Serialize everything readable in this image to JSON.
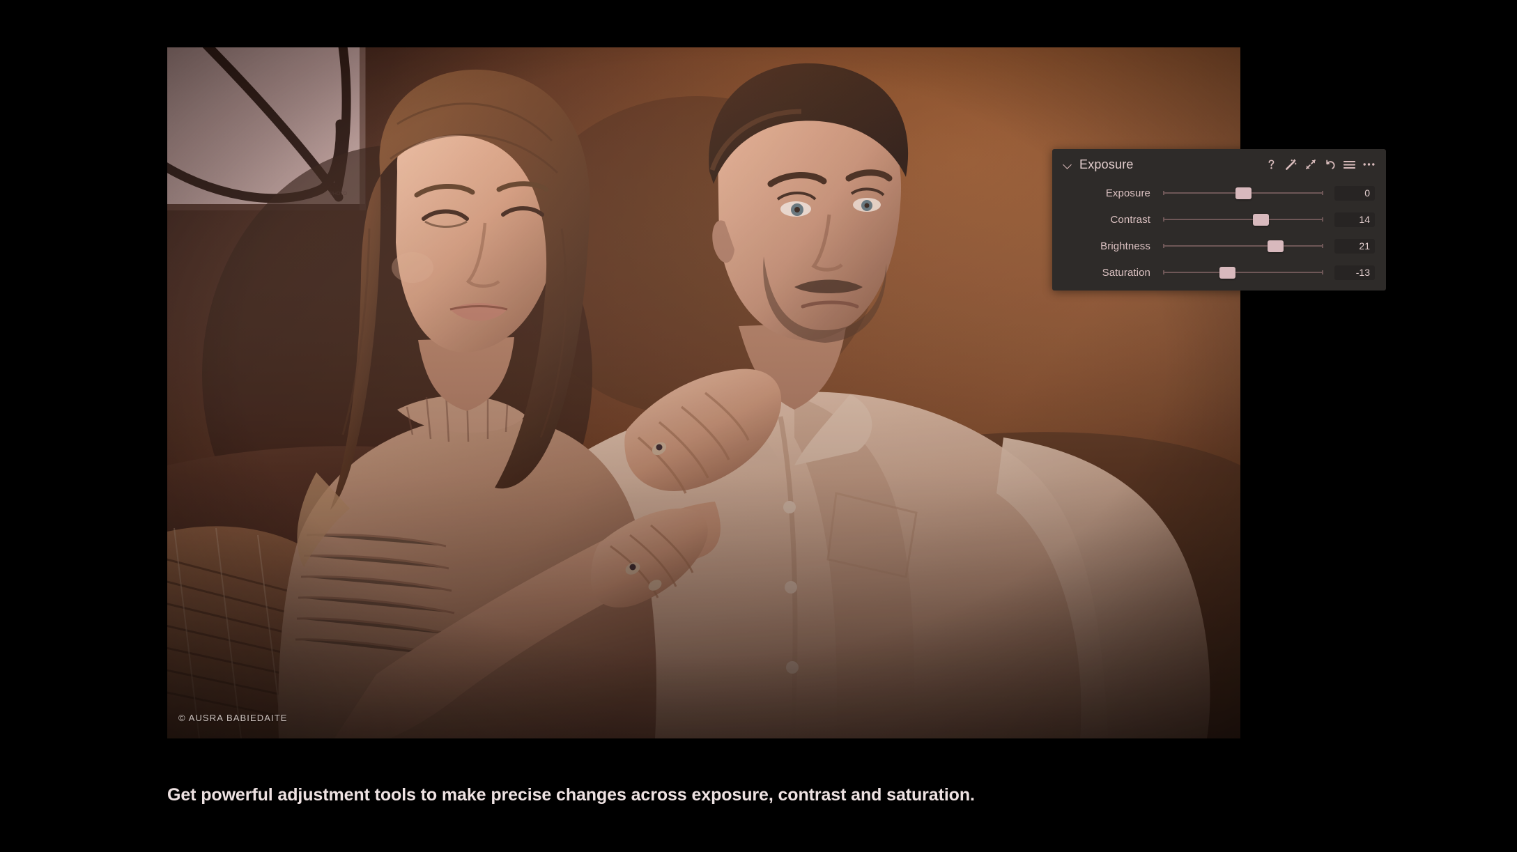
{
  "photo": {
    "watermark": "© AUSRA BABIEDAITE",
    "alt": "Couple seated on a sofa in a warm dim room, woman resting hand on man's shoulder",
    "palette": {
      "wall_warm": "#7a4427",
      "wall_dark": "#3a211a",
      "wall_deep": "#281511",
      "skin_light": "#e3b49c",
      "skin_mid": "#c08d74",
      "skin_shadow": "#8a5c49",
      "hair_dark": "#4a2c1f",
      "hair_mid": "#7d4f33",
      "shirt_light": "#e8cab6",
      "shirt_shadow": "#c39e89",
      "sweater": "#c49a83",
      "canvas_art": "#a78b8b",
      "canvas_line": "#2a1712",
      "sofa": "#4d2b21",
      "pillow": "#a36b4a"
    }
  },
  "panel": {
    "title": "Exposure",
    "collapse_icon": "chevron-down-icon",
    "header_icons": [
      {
        "name": "help-icon",
        "glyph": "?"
      },
      {
        "name": "magic-wand-icon",
        "glyph": "wand"
      },
      {
        "name": "expand-arrows-icon",
        "glyph": "arrows"
      },
      {
        "name": "undo-icon",
        "glyph": "undo"
      },
      {
        "name": "menu-icon",
        "glyph": "hamburger"
      },
      {
        "name": "more-options-icon",
        "glyph": "ellipsis"
      }
    ],
    "sliders": [
      {
        "label": "Exposure",
        "value": "0",
        "position_pct": 50
      },
      {
        "label": "Contrast",
        "value": "14",
        "position_pct": 61
      },
      {
        "label": "Brightness",
        "value": "21",
        "position_pct": 70
      },
      {
        "label": "Saturation",
        "value": "-13",
        "position_pct": 40
      }
    ],
    "colors": {
      "background": "#2e2b29",
      "label": "#dcc2c2",
      "value_field": "#272423",
      "handle": "#d8b9bd",
      "track": "#6e5757"
    }
  },
  "caption": {
    "text": "Get powerful adjustment tools to make precise changes across exposure, contrast and saturation.",
    "color": "#eee2e2"
  }
}
